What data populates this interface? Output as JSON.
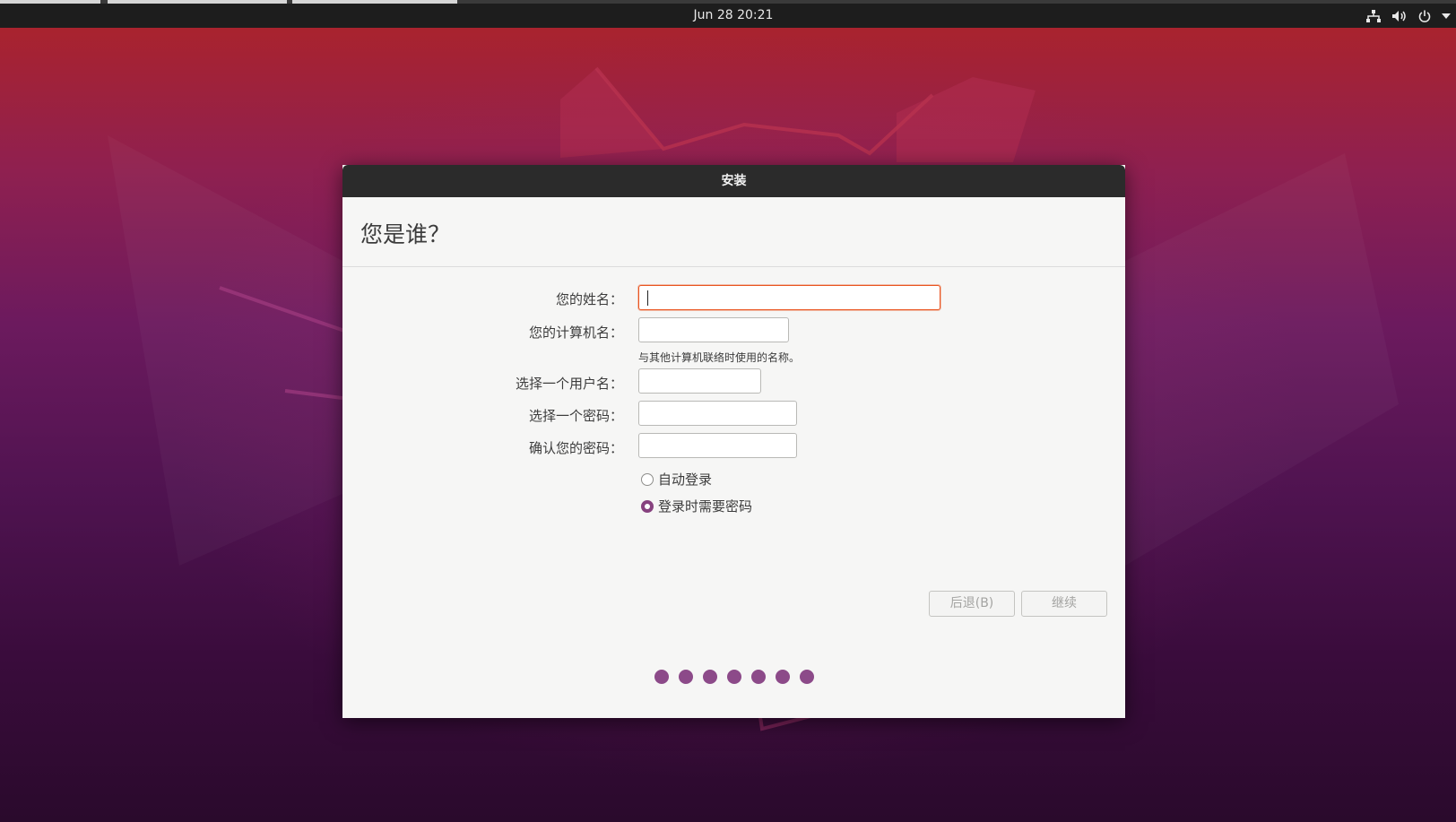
{
  "topbar": {
    "clock": "Jun 28  20:21",
    "icons": [
      "network-icon",
      "volume-icon",
      "power-icon",
      "menu-arrow-icon"
    ]
  },
  "window": {
    "title": "安装",
    "heading": "您是谁？",
    "form": {
      "name_label": "您的姓名：",
      "name_value": "",
      "computer_label": "您的计算机名：",
      "computer_value": "",
      "computer_hint": "与其他计算机联络时使用的名称。",
      "username_label": "选择一个用户名：",
      "username_value": "",
      "password_label": "选择一个密码：",
      "password_value": "",
      "confirm_label": "确认您的密码：",
      "confirm_value": ""
    },
    "login_options": {
      "auto_login": "自动登录",
      "require_password": "登录时需要密码",
      "selected": "require_password"
    },
    "buttons": {
      "back": "后退(B)",
      "continue": "继续"
    },
    "progress_dots": 7
  },
  "colors": {
    "accent_orange": "#e95420",
    "aubergine": "#8c4a89",
    "titlebar": "#2b2b2b",
    "topbar": "#1d1d1d"
  }
}
